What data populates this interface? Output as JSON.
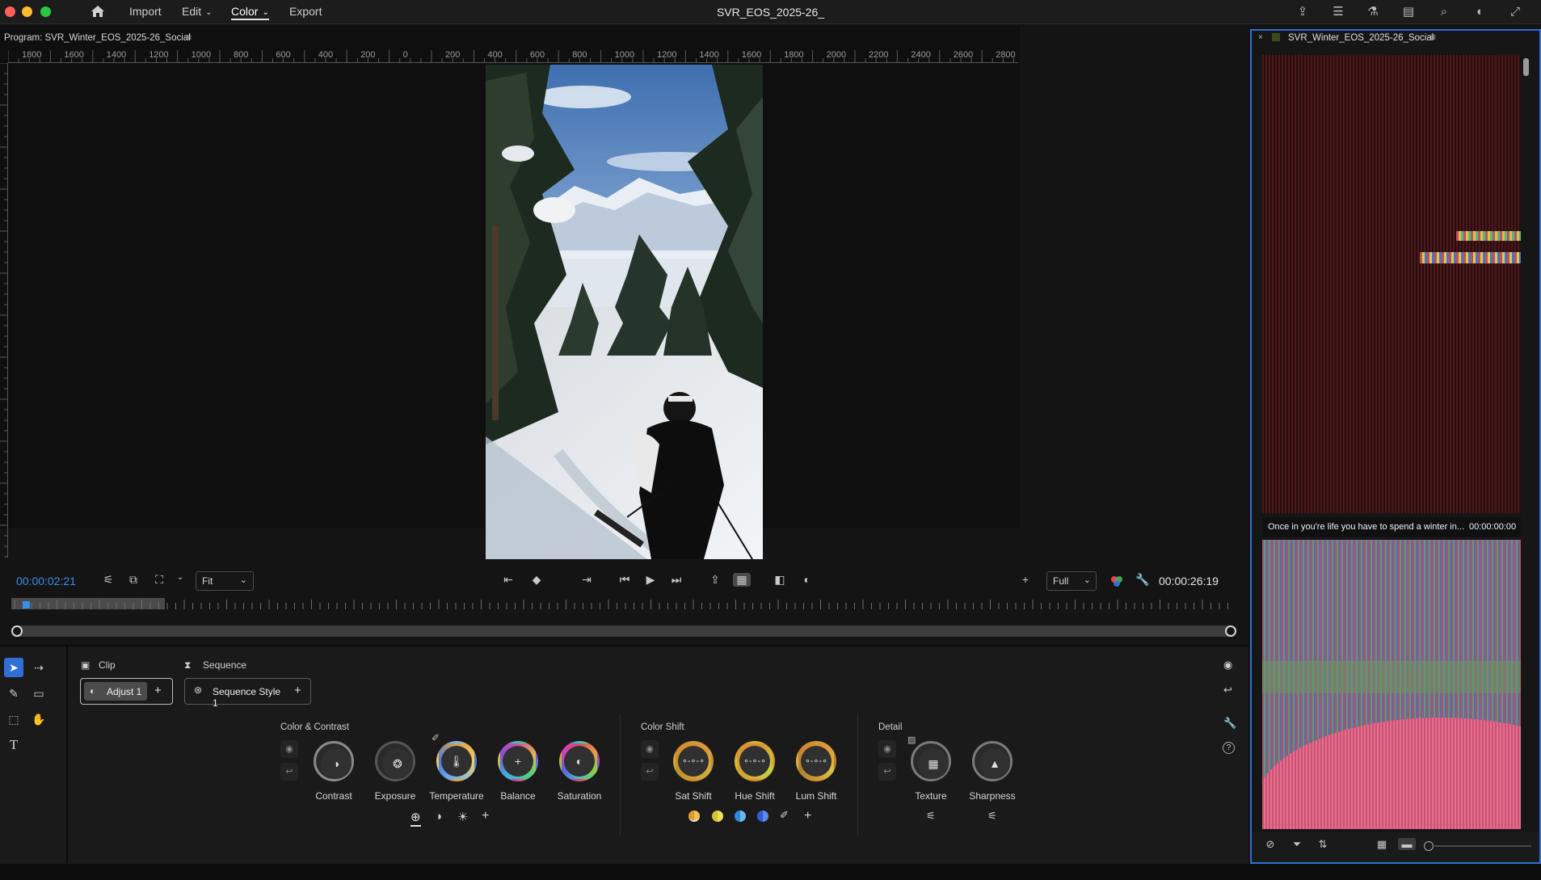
{
  "app": {
    "menu": [
      "Import",
      "Edit",
      "Color",
      "Export"
    ],
    "active_menu": "Color",
    "title": "SVR_EOS_2025-26_"
  },
  "program": {
    "label": "Program: SVR_Winter_EOS_2025-26_Social",
    "timecode": "00:00:02:21",
    "duration": "00:00:26:19",
    "fit": "Fit",
    "quality": "Full",
    "ruler": [
      "1800",
      "1600",
      "1400",
      "1200",
      "1000",
      "800",
      "600",
      "400",
      "200",
      "0",
      "200",
      "400",
      "600",
      "800",
      "1000",
      "1200",
      "1400",
      "1600",
      "1800",
      "2000",
      "2200",
      "2400",
      "2600",
      "2800"
    ]
  },
  "color_panel": {
    "tab_clip": "Clip",
    "tab_sequence": "Sequence",
    "adjust_chip": "Adjust 1",
    "sequence_chip": "Sequence Style 1",
    "color_contrast": {
      "label": "Color & Contrast",
      "knobs": [
        "Contrast",
        "Exposure",
        "Temperature",
        "Balance",
        "Saturation"
      ]
    },
    "color_shift": {
      "label": "Color Shift",
      "knobs": [
        "Sat Shift",
        "Hue Shift",
        "Lum Shift"
      ]
    },
    "detail": {
      "label": "Detail",
      "knobs": [
        "Texture",
        "Sharpness"
      ]
    }
  },
  "project_panel": {
    "title": "SVR_Winter_EOS_2025-26_Social",
    "clip_caption": "Once in you're life you have to spend a winter in...",
    "clip_timecode": "00:00:00:00"
  },
  "colors": {
    "accent": "#2f6fd6",
    "timecode": "#3a8ee8"
  }
}
